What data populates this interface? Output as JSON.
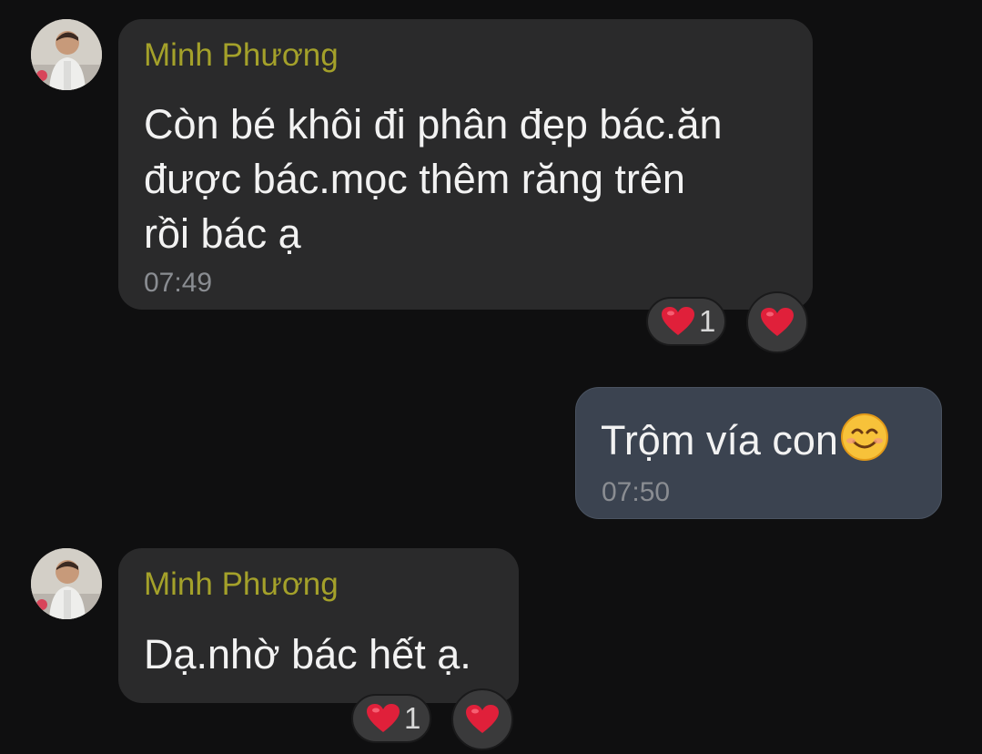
{
  "messages": [
    {
      "sender": "Minh Phương",
      "lines": [
        "Còn bé khôi đi phân đẹp bác.ăn",
        "được bác.mọc thêm răng trên",
        "rồi bác ạ"
      ],
      "time": "07:49",
      "reaction_count": "1",
      "reaction_icon": "red-heart-icon"
    },
    {
      "text": "Trộm vía con",
      "emoji": "smiling-face-icon",
      "time": "07:50"
    },
    {
      "sender": "Minh Phương",
      "lines": [
        "Dạ.nhờ bác hết ạ."
      ],
      "time": "",
      "reaction_count": "1",
      "reaction_icon": "red-heart-icon"
    }
  ],
  "colors": {
    "background": "#0f0f10",
    "incoming_bubble": "#2a2a2b",
    "outgoing_bubble": "#3b4350",
    "sender_name": "#a4a12a",
    "heart": "#e0203a"
  }
}
